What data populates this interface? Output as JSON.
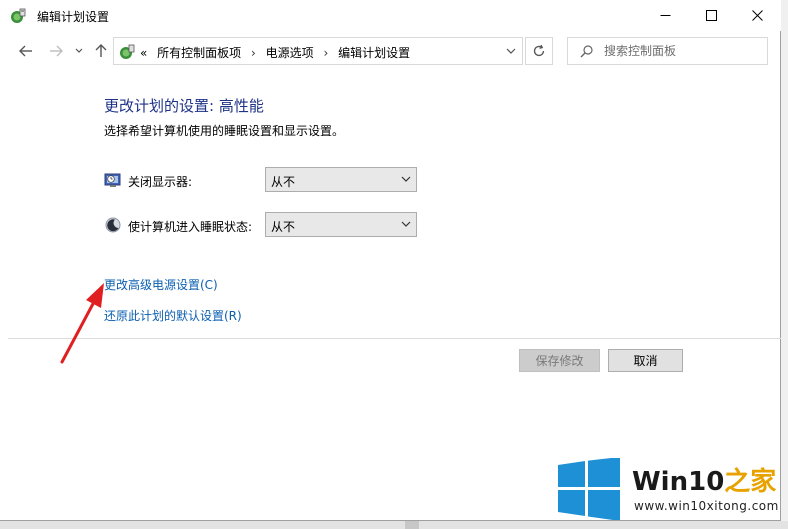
{
  "window": {
    "title": "编辑计划设置",
    "controls": {
      "minimize": "minimize",
      "maximize": "maximize",
      "close": "close"
    }
  },
  "address": {
    "crumbs": [
      "所有控制面板项",
      "电源选项",
      "编辑计划设置"
    ],
    "prefix": "«"
  },
  "search": {
    "placeholder": "搜索控制面板"
  },
  "content": {
    "title": "更改计划的设置: 高性能",
    "description": "选择希望计算机使用的睡眠设置和显示设置。",
    "settings": [
      {
        "label": "关闭显示器:",
        "value": "从不",
        "icon": "monitor-icon"
      },
      {
        "label": "使计算机进入睡眠状态:",
        "value": "从不",
        "icon": "sleep-moon-icon"
      }
    ],
    "links": [
      "更改高级电源设置(C)",
      "还原此计划的默认设置(R)"
    ]
  },
  "buttons": {
    "save": "保存修改",
    "cancel": "取消"
  },
  "watermark": {
    "brand_part1": "Win10",
    "brand_part2": "之家",
    "url": "www.win10xitong.com"
  },
  "colors": {
    "title_blue": "#1e3287",
    "link_blue": "#0b5fb0",
    "annotation_red": "#e02020",
    "windows_logo_blue": "#1e90d6"
  }
}
